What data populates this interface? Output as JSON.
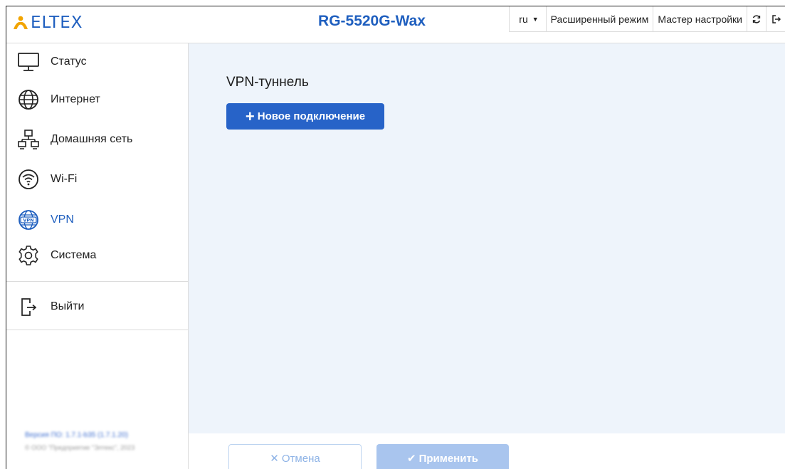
{
  "header": {
    "logo_text": "ELTEX",
    "model": "RG-5520G-Wax",
    "language": "ru",
    "advanced_mode": "Расширенный режим",
    "setup_wizard": "Мастер настройки",
    "refresh_icon": "refresh-icon",
    "logout_icon": "logout-icon"
  },
  "sidebar": {
    "items": [
      {
        "label": "Статус",
        "icon": "monitor-icon"
      },
      {
        "label": "Интернет",
        "icon": "globe-icon"
      },
      {
        "label": "Домашняя сеть",
        "icon": "network-icon"
      },
      {
        "label": "Wi-Fi",
        "icon": "wifi-icon"
      },
      {
        "label": "VPN",
        "icon": "vpn-globe-icon",
        "active": true
      },
      {
        "label": "Система",
        "icon": "gear-icon"
      }
    ],
    "logout": {
      "label": "Выйти",
      "icon": "exit-icon"
    },
    "footer": {
      "version": "Версия ПО: 1.7.1-b35 (1.7.1.20)",
      "copyright": "© ООО \"Предприятие \"Элтекс\", 2023"
    }
  },
  "main": {
    "title": "VPN-туннель",
    "new_connection_button": "Новое подключение"
  },
  "actions": {
    "cancel": "Отмена",
    "apply": "Применить"
  },
  "colors": {
    "brand": "#1f5fbf",
    "primary_button": "#2763c8",
    "content_bg": "#eef4fb",
    "disabled_button": "#a9c5ee"
  }
}
